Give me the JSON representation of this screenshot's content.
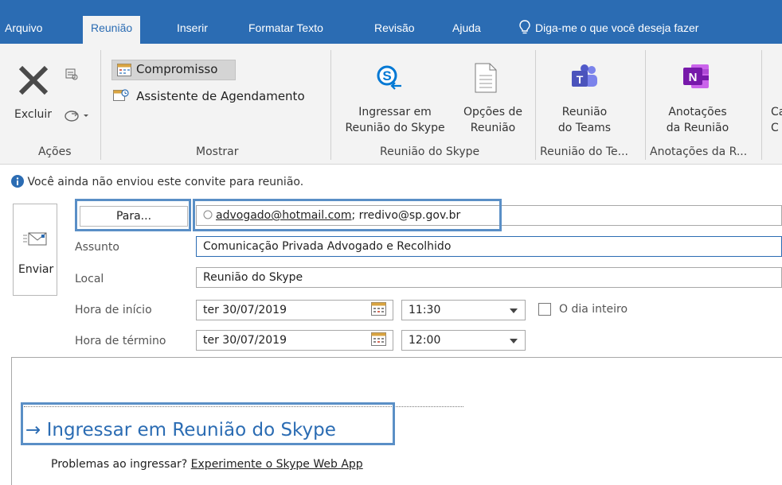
{
  "tabs": {
    "arquivo": "Arquivo",
    "reuniao": "Reunião",
    "inserir": "Inserir",
    "formatar": "Formatar Texto",
    "revisao": "Revisão",
    "ajuda": "Ajuda",
    "search": "Diga-me o que você deseja fazer"
  },
  "ribbon": {
    "excluir": "Excluir",
    "acoes": "Ações",
    "compromisso": "Compromisso",
    "assistente": "Assistente de Agendamento",
    "mostrar": "Mostrar",
    "ingressar_l1": "Ingressar em",
    "ingressar_l2": "Reunião do Skype",
    "opcoes_l1": "Opções de",
    "opcoes_l2": "Reunião",
    "grupo_skype": "Reunião do Skype",
    "teams_l1": "Reunião",
    "teams_l2": "do Teams",
    "grupo_teams": "Reunião do Te...",
    "anot_l1": "Anotações",
    "anot_l2": "da Reunião",
    "grupo_anot": "Anotações da R...",
    "cut_l1": "Ca",
    "cut_l2": "C"
  },
  "info": "Você ainda não enviou este convite para reunião.",
  "form": {
    "enviar": "Enviar",
    "para_button": "Para...",
    "to_primary": "advogado@hotmail.com",
    "to_rest": "; rredivo@sp.gov.br",
    "assunto_label": "Assunto",
    "assunto_value": "Comunicação Privada Advogado e Recolhido",
    "local_label": "Local",
    "local_value": "Reunião do Skype",
    "inicio_label": "Hora de início",
    "inicio_date": "ter 30/07/2019",
    "inicio_time": "11:30",
    "dia_inteiro": "O dia inteiro",
    "termino_label": "Hora de término",
    "termino_date": "ter 30/07/2019",
    "termino_time": "12:00"
  },
  "body": {
    "join_link": "Ingressar em Reunião do Skype",
    "problems": "Problemas ao ingressar? ",
    "web_app": "Experimente o Skype Web App"
  },
  "colors": {
    "tabbar": "#2b6cb3",
    "ribbon": "#f3f3f3",
    "highlight": "#5a8fc6",
    "teams": "#5059c9",
    "onenote": "#7719aa",
    "skype": "#0078d4"
  }
}
